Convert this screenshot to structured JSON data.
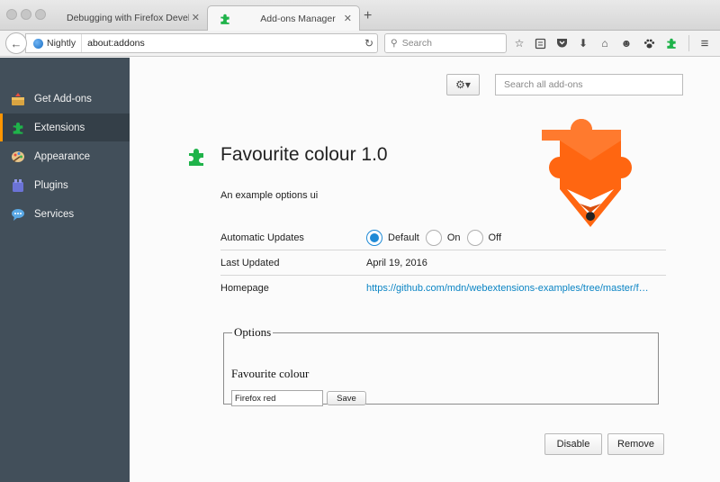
{
  "window": {
    "tabs": [
      {
        "title": "Debugging with Firefox Develop…",
        "active": false
      },
      {
        "title": "Add-ons Manager",
        "active": true
      }
    ],
    "new_tab_label": "+"
  },
  "navbar": {
    "identity_label": "Nightly",
    "url": "about:addons",
    "search_placeholder": "Search"
  },
  "sidebar": {
    "items": [
      {
        "label": "Get Add-ons",
        "icon": "get-addons-icon",
        "selected": false
      },
      {
        "label": "Extensions",
        "icon": "extensions-icon",
        "selected": true
      },
      {
        "label": "Appearance",
        "icon": "appearance-icon",
        "selected": false
      },
      {
        "label": "Plugins",
        "icon": "plugins-icon",
        "selected": false
      },
      {
        "label": "Services",
        "icon": "services-icon",
        "selected": false
      }
    ]
  },
  "toolbar": {
    "gear_label": "⚙▾",
    "search_placeholder": "Search all add-ons"
  },
  "addon": {
    "name": "Favourite colour 1.0",
    "description": "An example options ui",
    "details": {
      "updates_label": "Automatic Updates",
      "updates_options": [
        "Default",
        "On",
        "Off"
      ],
      "updates_selected": "Default",
      "last_updated_label": "Last Updated",
      "last_updated_value": "April 19, 2016",
      "homepage_label": "Homepage",
      "homepage_value": "https://github.com/mdn/webextensions-examples/tree/master/f…"
    }
  },
  "options": {
    "legend": "Options",
    "field_label": "Favourite colour",
    "field_value": "Firefox red",
    "save_label": "Save"
  },
  "actions": {
    "disable_label": "Disable",
    "remove_label": "Remove"
  },
  "colors": {
    "sidebar_bg": "#424f5a",
    "selected_accent": "#ff9500",
    "link": "#0a84c4",
    "radio_accent": "#1f8ad6",
    "puzzle_green": "#1fb34a",
    "fox_orange": "#ff6611"
  }
}
